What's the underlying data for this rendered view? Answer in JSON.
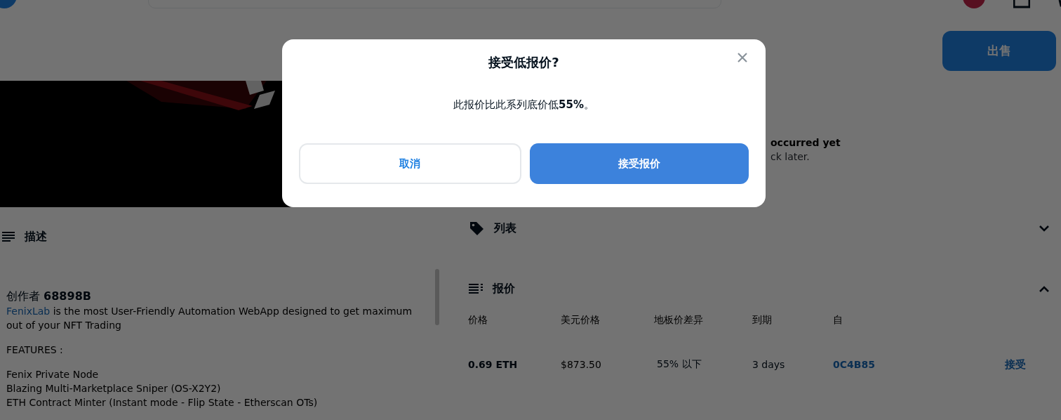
{
  "sell_button": "出售",
  "activity": {
    "lines": [
      "occurred yet",
      "ck later."
    ]
  },
  "description": {
    "title": "描述",
    "creator_label": "创作者",
    "creator": "68898B",
    "link": "FenixLab",
    "text": " is the most User-Friendly Automation WebApp designed to get maximum out of your NFT Trading",
    "features_title": "FEATURES :",
    "features": [
      "Fenix Private Node",
      "Blazing Multi-Marketplace Sniper (OS-X2Y2)",
      "ETH Contract Minter (Instant mode - Flip State - Etherscan OTs)"
    ]
  },
  "sections": [
    {
      "title": "列表",
      "kind": "tag",
      "expanded": false
    },
    {
      "title": "报价",
      "kind": "list",
      "expanded": true
    }
  ],
  "offers": {
    "columns": [
      "价格",
      "美元价格",
      "地板价差异",
      "到期",
      "自"
    ],
    "rows": [
      {
        "price": "0.69 ETH",
        "usd": "$873.50",
        "floor_diff": "55% 以下",
        "expiry": "3 days",
        "from": "0C4B85",
        "action": "接受"
      }
    ]
  },
  "modal": {
    "title": "接受低报价?",
    "message": "此报价比此系列底价低**55%**。",
    "buttons": [
      {
        "label": "取消",
        "kind": "secondary"
      },
      {
        "label": "接受报价",
        "kind": "primary"
      }
    ]
  }
}
